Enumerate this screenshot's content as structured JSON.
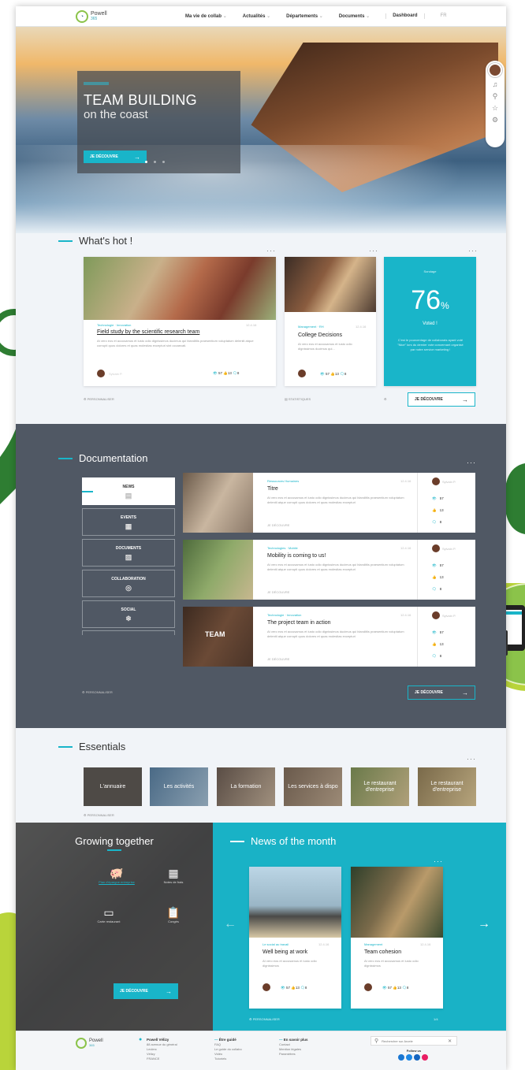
{
  "brand": {
    "name": "Powell",
    "sub": "365"
  },
  "nav": {
    "items": [
      "Ma vie de collab",
      "Actualités",
      "Départements",
      "Documents"
    ],
    "dashboard": "Dashboard",
    "lang": "FR"
  },
  "hero": {
    "title_line1": "TEAM BUILDING",
    "title_line2": "on the coast",
    "button": "JE DÉCOUVRE",
    "arrow": "→"
  },
  "whats_hot": {
    "title": "What's hot !",
    "more": "···",
    "card1": {
      "category": "Technologie · Innovation",
      "date": "12.4.16",
      "title": "Field study by the scientific research team",
      "text": "At vero eos et accusamus et iusto odio dignissimos ducimus qui blanditiis praesentium voluptatum deleniti atque corrupti quos dolores et quas molestias excepturi sint occaecati.",
      "author": "Sylvain P.",
      "views": "57",
      "likes": "13",
      "comments": "8"
    },
    "card2": {
      "category": "Management · RH",
      "date": "12.4.16",
      "title": "College Decisions",
      "text": "At vero eos et accusamus et iusto odio dignissimos ducimus qui...",
      "views": "57",
      "likes": "13",
      "comments": "8"
    },
    "poll": {
      "kicker": "Sondage",
      "value": "76",
      "unit": "%",
      "label": "Voted !",
      "text": "C'est le pourcentage de collaborats ayant voté \"Nice\" lors du dernier vote concernant organisé par notre service marketing !"
    },
    "personalize": "PERSONNALISER",
    "stats_link": "STATISTIQUES",
    "button": "JE DÉCOUVRE"
  },
  "documentation": {
    "title": "Documentation",
    "more": "···",
    "tabs": [
      "NEWS",
      "EVENTS",
      "DOCUMENTS",
      "COLLABORATION",
      "SOCIAL"
    ],
    "tab_icons": [
      "▤",
      "▦",
      "▨",
      "◎",
      "❄"
    ],
    "rows": [
      {
        "category": "Ressources Humaines",
        "date": "12.4.16",
        "title": "Titre",
        "text": "At vero eos et accusamus et iusto odio dignissimos ducimus qui blanditiis praesentium voluptatum deleniti atque corrupti quos dolores et quas molestias excepturi",
        "link": "JE DÉCOUVRE",
        "author": "Sylvain P.",
        "views": "57",
        "likes": "13",
        "comments": "8"
      },
      {
        "category": "Technologies · Mobile",
        "date": "12.4.16",
        "title": "Mobility is coming to us!",
        "text": "At vero eos et accusamus et iusto odio dignissimos ducimus qui blanditiis praesentium voluptatum deleniti atque corrupti quos dolores et quas molestias excepturi",
        "link": "JE DÉCOUVRE",
        "author": "Sylvain P.",
        "views": "57",
        "likes": "13",
        "comments": "8"
      },
      {
        "category": "Technologie · Innovation",
        "date": "12.4.16",
        "title": "The project team in action",
        "text": "At vero eos et accusamus et iusto odio dignissimos ducimus qui blanditiis praesentium voluptatum deleniti atque corrupti quos dolores et quas molestias excepturi",
        "link": "JE DÉCOUVRE",
        "author": "Sylvain P.",
        "views": "57",
        "likes": "13",
        "comments": "8"
      }
    ],
    "personalize": "PERSONNALISER",
    "button": "JE DÉCOUVRE",
    "team_text": "TEAM"
  },
  "essentials": {
    "title": "Essentials",
    "more": "···",
    "tiles": [
      "L'annuaire",
      "Les activités",
      "La formation",
      "Les services à dispo",
      "Le restaurant d'entreprise",
      "Le restaurant d'entreprise"
    ],
    "personalize": "PERSONNALISER"
  },
  "growing": {
    "title": "Growing together",
    "links": [
      "Plan d'épargne entreprise",
      "Notes de frais",
      "Carte restaurant",
      "Congés"
    ],
    "button": "JE DÉCOUVRE"
  },
  "news_month": {
    "title": "News of the month",
    "more": "···",
    "card1": {
      "category": "Le social au travail",
      "date": "12.4.16",
      "title": "Well being at work",
      "text": "At vero eos et accusamus et iusto odio dignissimos",
      "views": "57",
      "likes": "13",
      "comments": "8"
    },
    "card2": {
      "category": "Management",
      "date": "12.4.16",
      "title": "Team cohesion",
      "text": "At vero eos et accusamus et iusto odio dignissimos",
      "views": "57",
      "likes": "13",
      "comments": "8"
    },
    "personalize": "PERSONNALISER",
    "pager": "1/4",
    "prev": "←",
    "next": "→"
  },
  "footer": {
    "brand": "Powell",
    "brand_sub": "365",
    "col1_title": "Powell Vélizy",
    "col1_lines": [
      "88 avenue du général",
      "Leclerc",
      "Vélizy",
      "FRANCE"
    ],
    "col2_title": "Être guidé",
    "col2_lines": [
      "FAQ",
      "Le guide du collabo",
      "Vidéo",
      "Tutoriels"
    ],
    "col3_title": "En savoir plus",
    "col3_lines": [
      "Contact",
      "Mention légales",
      "Paramètres"
    ],
    "search_placeholder": "Rechercher sur Arcele",
    "follow": "Follow us"
  },
  "colors": {
    "accent": "#19b5c9",
    "dark": "#505864",
    "green": "#8bc34a",
    "deco_green": "#2e7d32"
  },
  "icons": [
    "search-icon",
    "bell-icon",
    "star-icon",
    "gear-icon",
    "eye-icon",
    "thumb-icon",
    "comment-icon",
    "arrow-right-icon",
    "piggy-bank-icon",
    "calculator-icon",
    "card-icon",
    "clipboard-icon"
  ]
}
